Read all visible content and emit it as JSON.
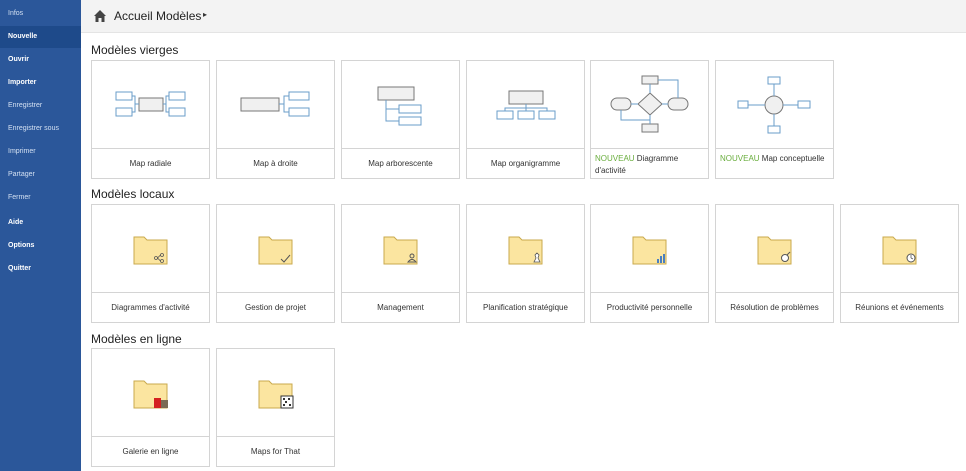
{
  "sidebar": {
    "items": [
      {
        "label": "Infos"
      },
      {
        "label": "Nouvelle"
      },
      {
        "label": "Ouvrir"
      },
      {
        "label": "Importer"
      },
      {
        "label": "Enregistrer"
      },
      {
        "label": "Enregistrer sous"
      },
      {
        "label": "Imprimer"
      },
      {
        "label": "Partager"
      },
      {
        "label": "Fermer"
      },
      {
        "label": "Aide"
      },
      {
        "label": "Options"
      },
      {
        "label": "Quitter"
      }
    ]
  },
  "header": {
    "breadcrumb": "Accueil Modèles",
    "arrow": "▸"
  },
  "sections": {
    "vierges": {
      "title": "Modèles vierges",
      "tiles": [
        {
          "label": "Map radiale"
        },
        {
          "label": "Map à droite"
        },
        {
          "label": "Map arborescente"
        },
        {
          "label": "Map organigramme"
        },
        {
          "badge": "NOUVEAU",
          "label": "Diagramme d'activité"
        },
        {
          "badge": "NOUVEAU",
          "label": "Map conceptuelle"
        }
      ]
    },
    "locaux": {
      "title": "Modèles locaux",
      "tiles": [
        {
          "label": "Diagrammes d'activité"
        },
        {
          "label": "Gestion de projet"
        },
        {
          "label": "Management"
        },
        {
          "label": "Planification stratégique"
        },
        {
          "label": "Productivité personnelle"
        },
        {
          "label": "Résolution de problèmes"
        },
        {
          "label": "Réunions et événements"
        }
      ]
    },
    "en_ligne": {
      "title": "Modèles en ligne",
      "tiles": [
        {
          "label": "Galerie en ligne"
        },
        {
          "label": "Maps for That"
        }
      ]
    }
  },
  "colors": {
    "sidebar": "#2b579a",
    "sidebar_active": "#1e4a8a",
    "badge_new": "#6aae3e",
    "diagram_stroke": "#6a9cc9",
    "folder_fill": "#fbe5a0"
  }
}
